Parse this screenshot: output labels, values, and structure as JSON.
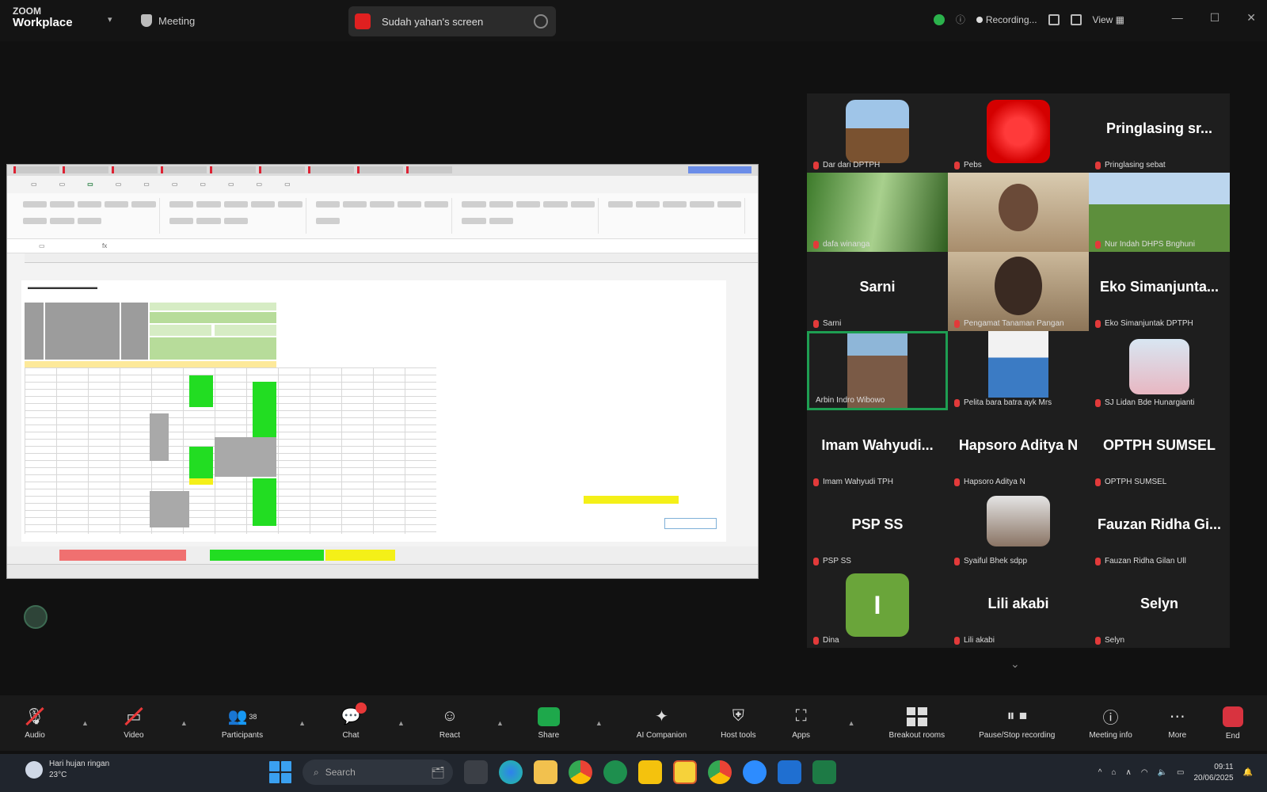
{
  "topbar": {
    "brand_line1": "ZOOM",
    "brand_line2": "Workplace",
    "meeting_label": "Meeting",
    "share_banner": "Sudah yahan's screen",
    "recording_label": "Recording...",
    "view_label": "View"
  },
  "gallery": {
    "tiles": [
      {
        "display": "",
        "label": "Dar dari DPTPH"
      },
      {
        "display": "",
        "label": "Pebs"
      },
      {
        "display": "Pringlasing sr...",
        "label": "Pringlasing sebat"
      },
      {
        "display": "",
        "label": "dafa winanga"
      },
      {
        "display": "",
        "label": ""
      },
      {
        "display": "",
        "label": "Nur Indah DHPS Bnghuni"
      },
      {
        "display": "Sarni",
        "label": "Sarni"
      },
      {
        "display": "",
        "label": "Pengamat Tanaman Pangan"
      },
      {
        "display": "Eko Simanjunta...",
        "label": "Eko Simanjuntak DPTPH"
      },
      {
        "display": "",
        "label": "Arbin Indro Wibowo"
      },
      {
        "display": "",
        "label": "Pelita bara batra ayk Mrs"
      },
      {
        "display": "",
        "label": "SJ Lidan Bde Hunargianti"
      },
      {
        "display": "Imam Wahyudi...",
        "label": "Imam Wahyudi TPH"
      },
      {
        "display": "Hapsoro Aditya N",
        "label": "Hapsoro Aditya N"
      },
      {
        "display": "OPTPH SUMSEL",
        "label": "OPTPH SUMSEL"
      },
      {
        "display": "PSP SS",
        "label": "PSP SS"
      },
      {
        "display": "",
        "label": "Syaiful Bhek sdpp"
      },
      {
        "display": "Fauzan Ridha Gi...",
        "label": "Fauzan Ridha Gilan Ull"
      },
      {
        "display": "",
        "label": "Dina"
      },
      {
        "display": "Lili akabi",
        "label": "Lili akabi"
      },
      {
        "display": "Selyn",
        "label": "Selyn"
      }
    ]
  },
  "toolbar": {
    "audio": "Audio",
    "video": "Video",
    "participants": "Participants",
    "participants_count": "38",
    "chat": "Chat",
    "react": "React",
    "share": "Share",
    "ai_companion": "AI Companion",
    "host_tools": "Host tools",
    "apps": "Apps",
    "breakout_rooms": "Breakout rooms",
    "recording": "Pause/Stop recording",
    "meeting_info": "Meeting info",
    "more": "More",
    "end": "End"
  },
  "taskbar": {
    "weather_temp": "Hari hujan ringan",
    "weather_sub": "23°C",
    "search_placeholder": "Search",
    "time": "09:11",
    "date": "20/06/2025"
  },
  "colors": {
    "background": "#111111",
    "share_green": "#1ea84b",
    "active_speaker": "#1e9e52",
    "end_red": "#d8333f"
  }
}
